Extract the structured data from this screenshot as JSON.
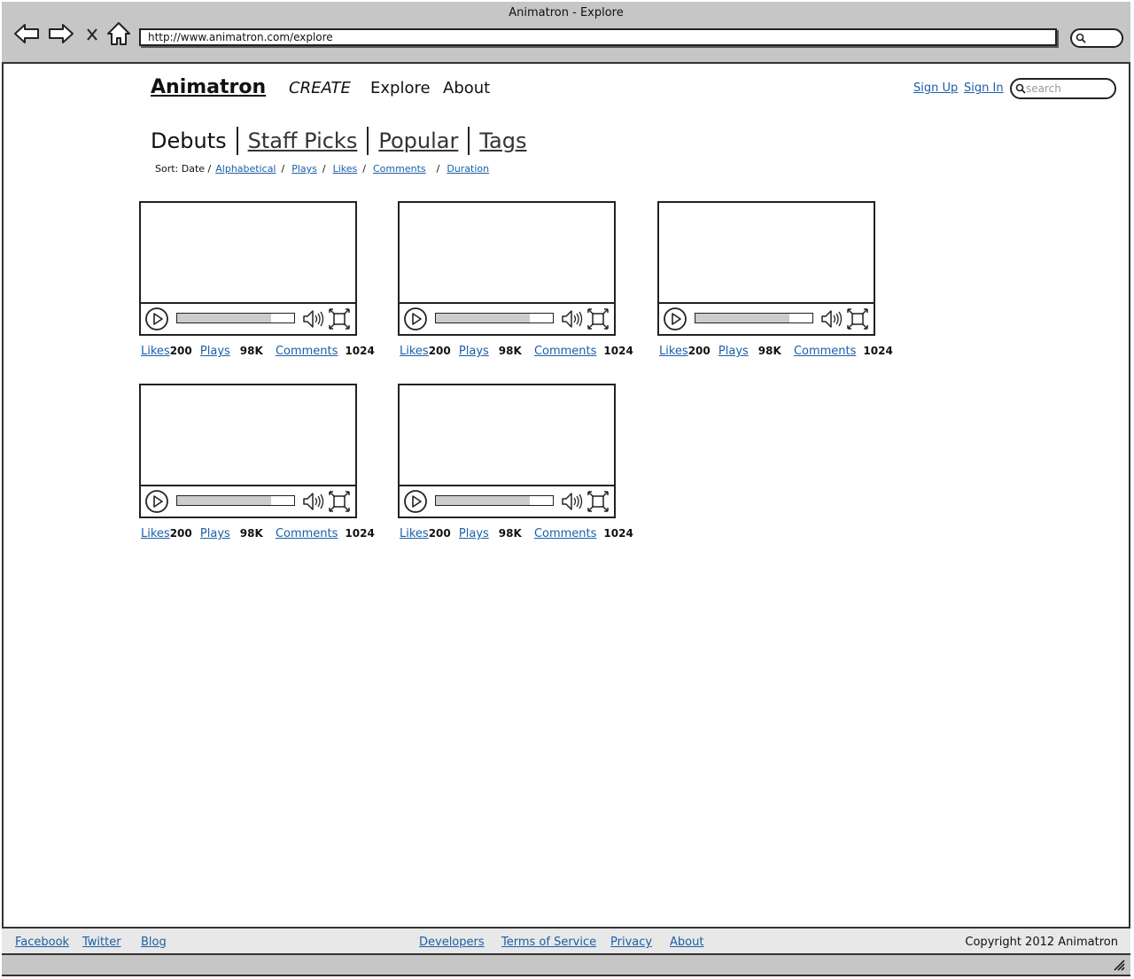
{
  "browser": {
    "window_title": "Animatron - Explore",
    "url": "http://www.animatron.com/explore",
    "icons": [
      "back-arrow-icon",
      "forward-arrow-icon",
      "close-x-icon",
      "home-icon",
      "search-icon"
    ]
  },
  "header": {
    "logo": "Animatron",
    "nav": {
      "create": "CREATE",
      "explore": "Explore",
      "about": "About"
    },
    "sign_up": "Sign Up",
    "sign_in": "Sign In",
    "search_placeholder": "search"
  },
  "tabs": [
    "Debuts",
    "Staff Picks",
    "Popular",
    "Tags"
  ],
  "sort": {
    "prefix": "Sort: Date /",
    "options": [
      "Alphabetical",
      "Plays",
      "Likes",
      "Comments",
      "Duration"
    ]
  },
  "videos": [
    {
      "likes_label": "Likes",
      "likes": "200",
      "plays_label": "Plays",
      "plays": "98K",
      "comments_label": "Comments",
      "comments": "1024",
      "progress": 0.8
    },
    {
      "likes_label": "Likes",
      "likes": "200",
      "plays_label": "Plays",
      "plays": "98K",
      "comments_label": "Comments",
      "comments": "1024",
      "progress": 0.8
    },
    {
      "likes_label": "Likes",
      "likes": "200",
      "plays_label": "Plays",
      "plays": "98K",
      "comments_label": "Comments",
      "comments": "1024",
      "progress": 0.8
    },
    {
      "likes_label": "Likes",
      "likes": "200",
      "plays_label": "Plays",
      "plays": "98K",
      "comments_label": "Comments",
      "comments": "1024",
      "progress": 0.8
    },
    {
      "likes_label": "Likes",
      "likes": "200",
      "plays_label": "Plays",
      "plays": "98K",
      "comments_label": "Comments",
      "comments": "1024",
      "progress": 0.8
    }
  ],
  "footer": {
    "left_links": [
      "Facebook",
      "Twitter",
      "Blog"
    ],
    "center_links": [
      "Developers",
      "Terms of Service",
      "Privacy",
      "About"
    ],
    "copyright": "Copyright 2012 Animatron"
  }
}
